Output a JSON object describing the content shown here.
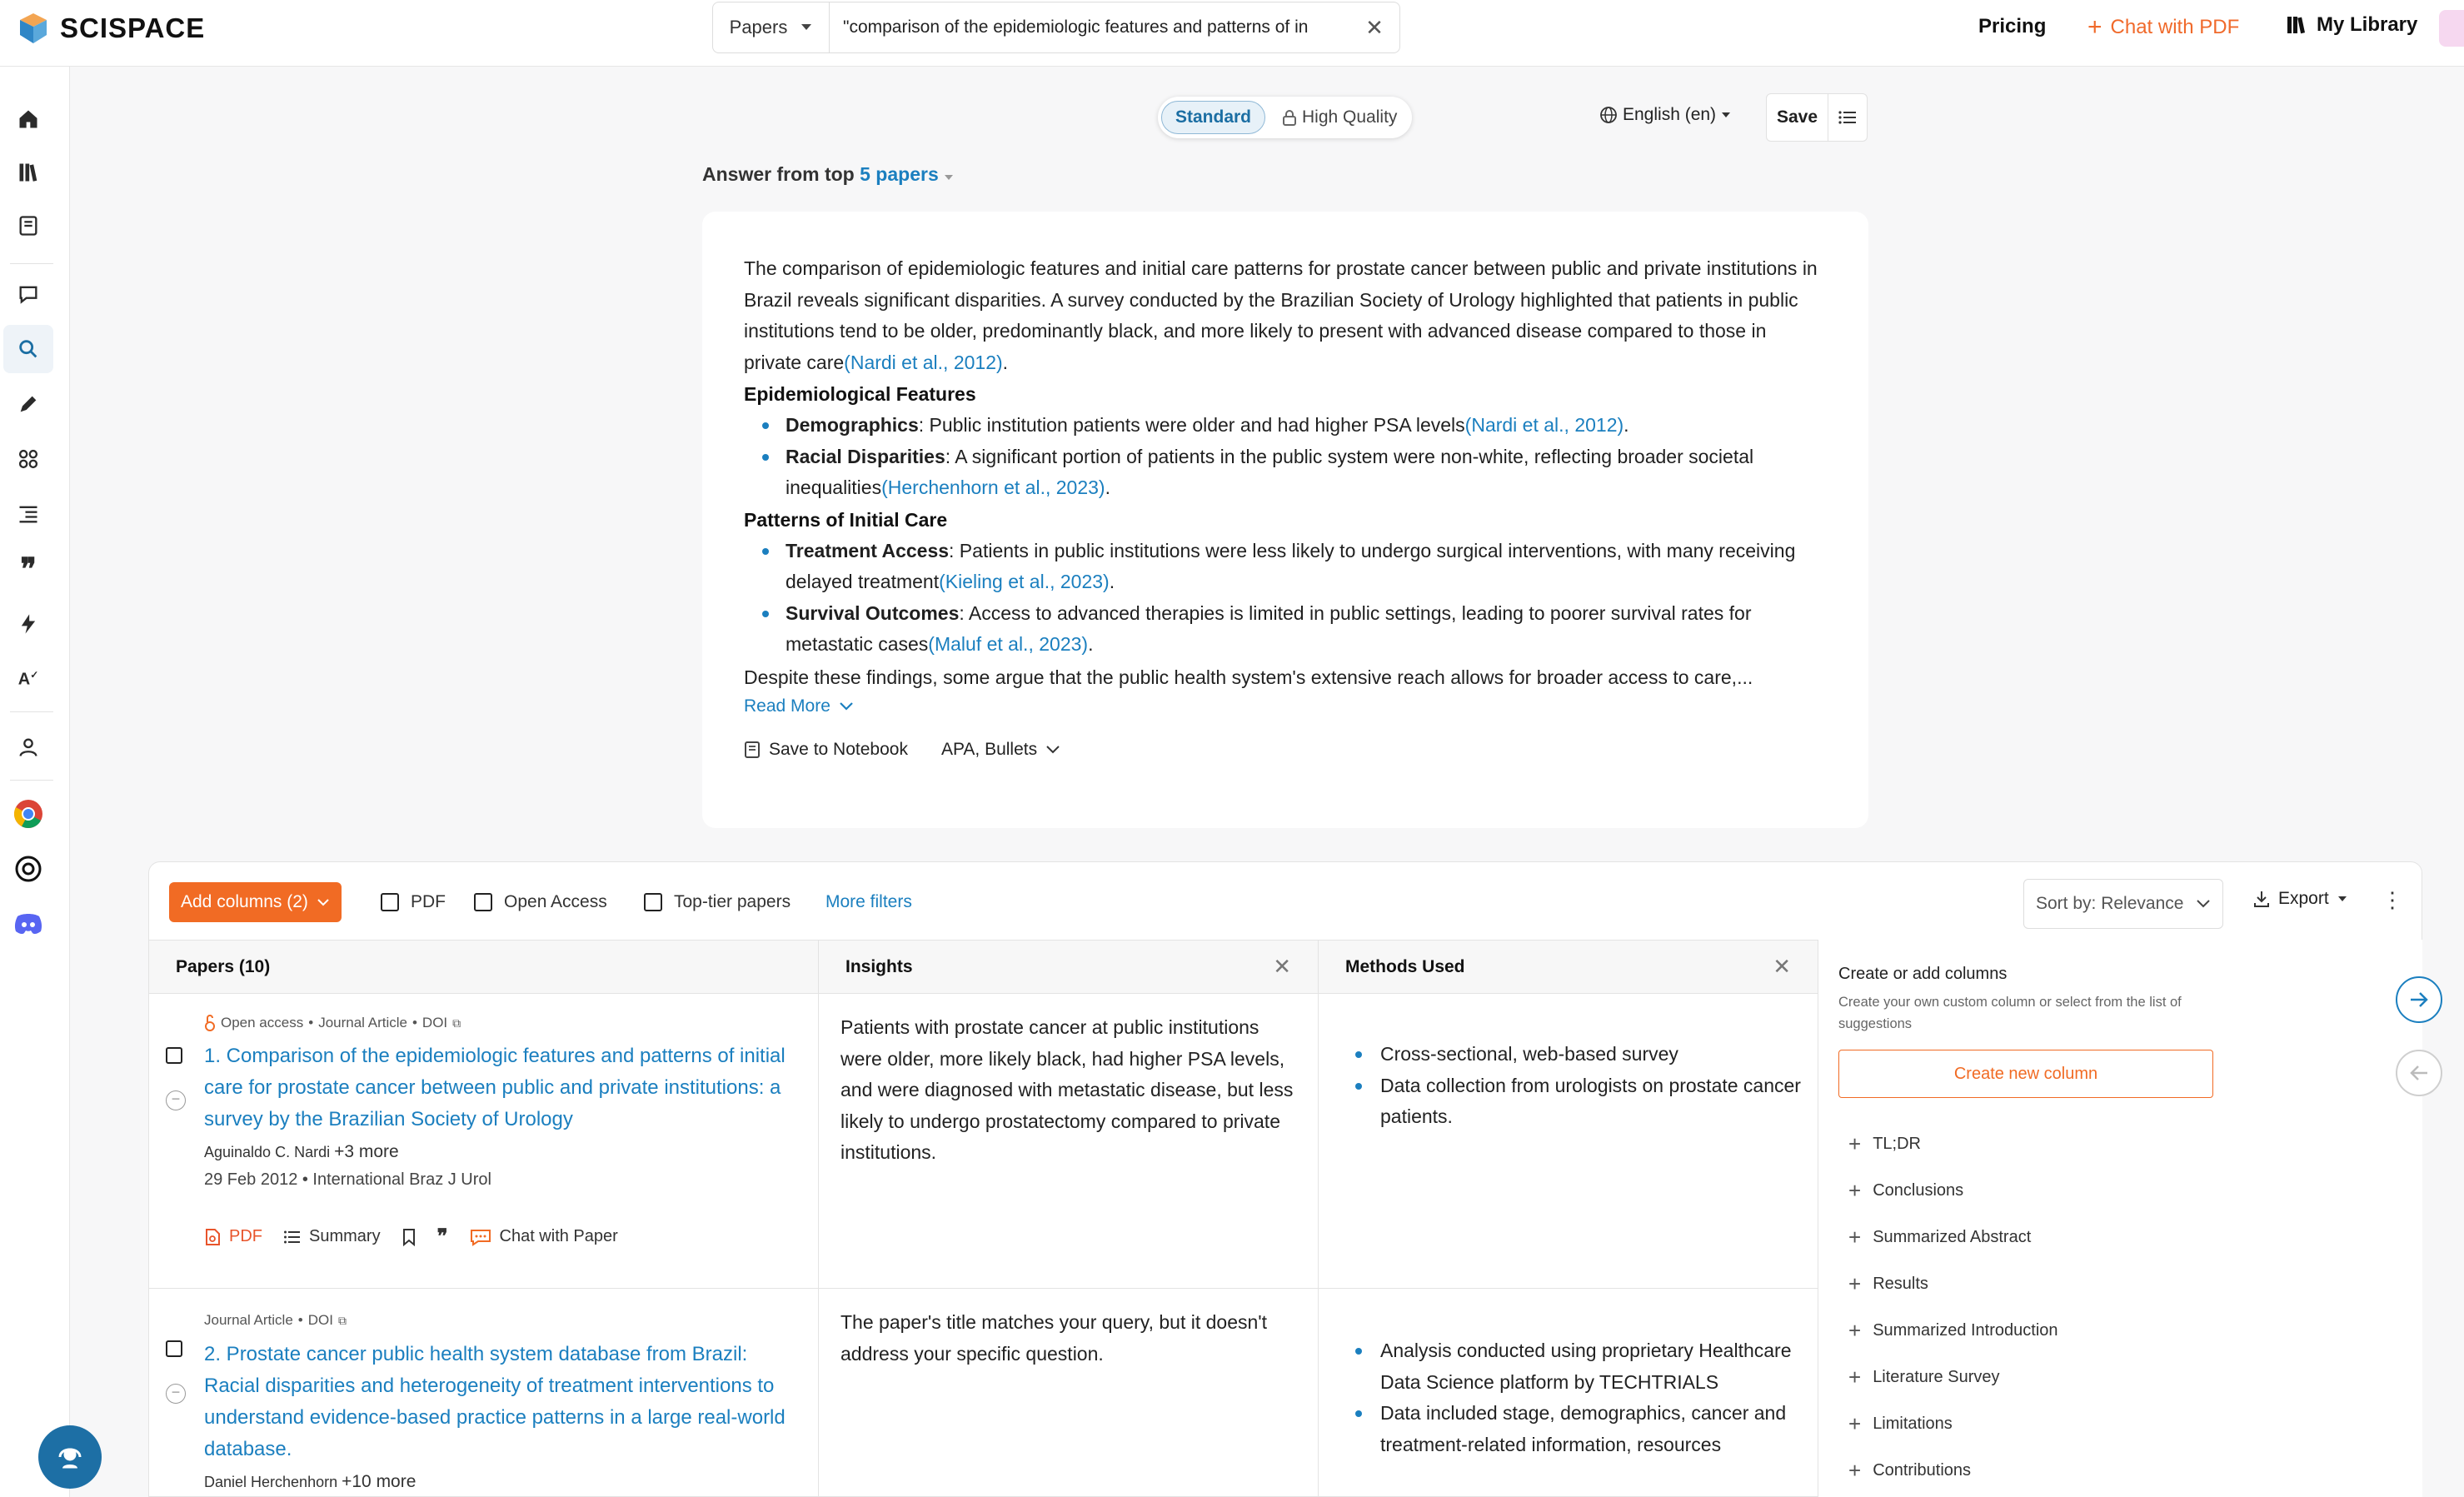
{
  "header": {
    "brand": "SCISPACE",
    "search_type": "Papers",
    "search_query": "\"comparison of the epidemiologic features and patterns of in",
    "nav": {
      "pricing": "Pricing",
      "chat_pdf": "Chat with PDF",
      "library": "My Library"
    }
  },
  "toolbar": {
    "mode_standard": "Standard",
    "mode_hq": "High Quality",
    "language": "English (en)",
    "save": "Save"
  },
  "answer": {
    "header_prefix": "Answer from top",
    "header_link": "5 papers",
    "intro": "The comparison of epidemiologic features and initial care patterns for prostate cancer between public and private institutions in Brazil reveals significant disparities. A survey conducted by the Brazilian Society of Urology highlighted that patients in public institutions tend to be older, predominantly black, and more likely to present with advanced disease compared to those in private care",
    "intro_cite": "(Nardi et al., 2012)",
    "sec1_title": "Epidemiological Features",
    "sec1_items": [
      {
        "label": "Demographics",
        "text": ": Public institution patients were older and had higher PSA levels",
        "cite": "(Nardi et al., 2012)"
      },
      {
        "label": "Racial Disparities",
        "text": ": A significant portion of patients in the public system were non-white, reflecting broader societal inequalities",
        "cite": "(Herchenhorn et al., 2023)"
      }
    ],
    "sec2_title": "Patterns of Initial Care",
    "sec2_items": [
      {
        "label": "Treatment Access",
        "text": ": Patients in public institutions were less likely to undergo surgical interventions, with many receiving delayed treatment",
        "cite": "(Kieling et al., 2023)"
      },
      {
        "label": "Survival Outcomes",
        "text": ": Access to advanced therapies is limited in public settings, leading to poorer survival rates for metastatic cases",
        "cite": "(Maluf et al., 2023)"
      }
    ],
    "closing": "Despite these findings, some argue that the public health system's extensive reach allows for broader access to care,...",
    "read_more": "Read More",
    "save_notebook": "Save to Notebook",
    "citation_style": "APA, Bullets"
  },
  "filters": {
    "add_columns": "Add columns (2)",
    "pdf": "PDF",
    "open_access": "Open Access",
    "top_tier": "Top-tier papers",
    "more_filters": "More filters",
    "sort": "Sort by: Relevance",
    "export": "Export"
  },
  "table": {
    "col_papers": "Papers (10)",
    "col_insights": "Insights",
    "col_methods": "Methods Used",
    "rows": [
      {
        "meta_prefix": "Open access",
        "meta_type": "Journal Article",
        "meta_doi": "DOI",
        "title": "1. Comparison of the epidemiologic features and patterns of initial care for prostate cancer between public and private institutions: a survey by the Brazilian Society of Urology",
        "author": "Aguinaldo C. Nardi",
        "more": "+3 more",
        "date_journal": "29 Feb 2012 • International Braz J Urol",
        "insight": "Patients with prostate cancer at public institutions were older, more likely black, had higher PSA levels, and were diagnosed with metastatic disease, but less likely to undergo prostatectomy compared to private institutions.",
        "methods": [
          "Cross-sectional, web-based survey",
          "Data collection from urologists on prostate cancer patients."
        ]
      },
      {
        "meta_type": "Journal Article",
        "meta_doi": "DOI",
        "title": "2. Prostate cancer public health system database from Brazil: Racial disparities and heterogeneity of treatment interventions to understand evidence-based practice patterns in a large real-world database.",
        "author": "Daniel Herchenhorn",
        "more": "+10 more",
        "insight": "The paper's title matches your query, but it doesn't address your specific question.",
        "methods": [
          "Analysis conducted using proprietary Healthcare Data Science platform by TECHTRIALS",
          "Data included stage, demographics, cancer and treatment-related information, resources"
        ]
      }
    ],
    "actions": {
      "pdf": "PDF",
      "summary": "Summary",
      "chat": "Chat with Paper"
    }
  },
  "suggestions": {
    "title": "Create or add columns",
    "desc": "Create your own custom column or select from the list of suggestions",
    "create": "Create new column",
    "items": [
      "TL;DR",
      "Conclusions",
      "Summarized Abstract",
      "Results",
      "Summarized Introduction",
      "Literature Survey",
      "Limitations",
      "Contributions"
    ]
  },
  "colors": {
    "accent": "#1b7fbf",
    "brand_orange": "#f16b24"
  }
}
